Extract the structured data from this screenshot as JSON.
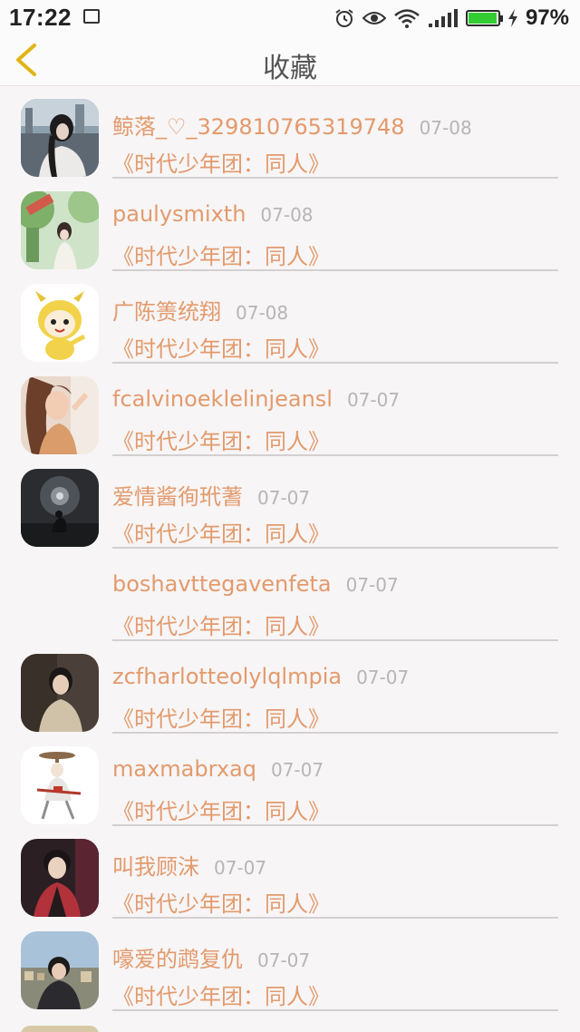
{
  "status_bar": {
    "time": "17:22",
    "battery_pct": "97%"
  },
  "header": {
    "title": "收藏"
  },
  "items": [
    {
      "name": "鲸落_♡_329810765319748",
      "date": "07-08",
      "book": "《时代少年团：同人》",
      "avatar": "photo"
    },
    {
      "name": "paulysmixth",
      "date": "07-08",
      "book": "《时代少年团：同人》",
      "avatar": "photo"
    },
    {
      "name": "广陈箦统翔",
      "date": "07-08",
      "book": "《时代少年团：同人》",
      "avatar": "cartoon"
    },
    {
      "name": "fcalvinoeklelinjeansl",
      "date": "07-07",
      "book": "《时代少年团：同人》",
      "avatar": "photo"
    },
    {
      "name": "爱情酱徇玳蓍",
      "date": "07-07",
      "book": "《时代少年团：同人》",
      "avatar": "photo"
    },
    {
      "name": "boshavttegavenfeta",
      "date": "07-07",
      "book": "《时代少年团：同人》",
      "avatar": "none"
    },
    {
      "name": "zcfharlotteolylqlmpia",
      "date": "07-07",
      "book": "《时代少年团：同人》",
      "avatar": "photo"
    },
    {
      "name": "maxmabrxaq",
      "date": "07-07",
      "book": "《时代少年团：同人》",
      "avatar": "illustration"
    },
    {
      "name": "叫我顾沫",
      "date": "07-07",
      "book": "《时代少年团：同人》",
      "avatar": "photo"
    },
    {
      "name": "嚎爱的鹉复仇",
      "date": "07-07",
      "book": "《时代少年团：同人》",
      "avatar": "photo"
    }
  ],
  "colors": {
    "accent": "#e39a6c",
    "back_arrow": "#e0b414",
    "date": "#b6b6b6",
    "battery": "#33cc33"
  },
  "icons": {
    "back": "chevron-left-icon",
    "alarm": "alarm-icon",
    "eye": "eye-icon",
    "wifi": "wifi-icon",
    "signal": "signal-icon",
    "battery": "battery-icon",
    "charging": "bolt-icon",
    "gallery": "image-icon"
  }
}
